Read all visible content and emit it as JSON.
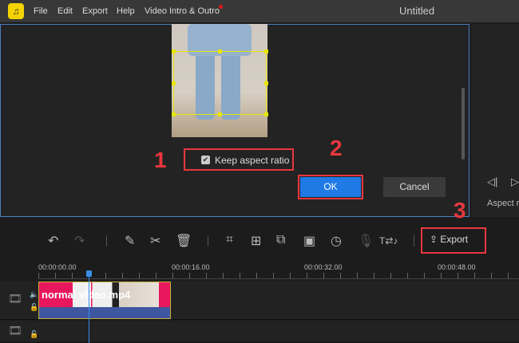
{
  "menu": {
    "logo": "logo-icon",
    "items": [
      "File",
      "Edit",
      "Export",
      "Help",
      "Video Intro & Outro"
    ],
    "window_title": "Untitled"
  },
  "dialog": {
    "keep_aspect_ratio": "Keep aspect ratio",
    "keep_aspect_checked": true,
    "ok": "OK",
    "cancel": "Cancel"
  },
  "annotations": [
    "1",
    "2",
    "3"
  ],
  "right_panel": {
    "label": "Aspect r"
  },
  "toolbar": {
    "icons": [
      "undo-icon",
      "redo-icon",
      "edit-icon",
      "cut-icon",
      "delete-icon",
      "crop-icon",
      "zoom-icon",
      "mosaic-icon",
      "freeze-icon",
      "speed-icon",
      "voiceover-icon",
      "text-to-speech-icon"
    ],
    "export": "Export"
  },
  "timeline": {
    "timecodes": [
      "00:00:00.00",
      "00:00:16.00",
      "00:00:32.00",
      "00:00:48.00"
    ],
    "clip_name": "normal video.mp4"
  },
  "colors": {
    "accent": "#1f7ae6",
    "annotation": "#e8383d",
    "clip": "#e8175d"
  }
}
